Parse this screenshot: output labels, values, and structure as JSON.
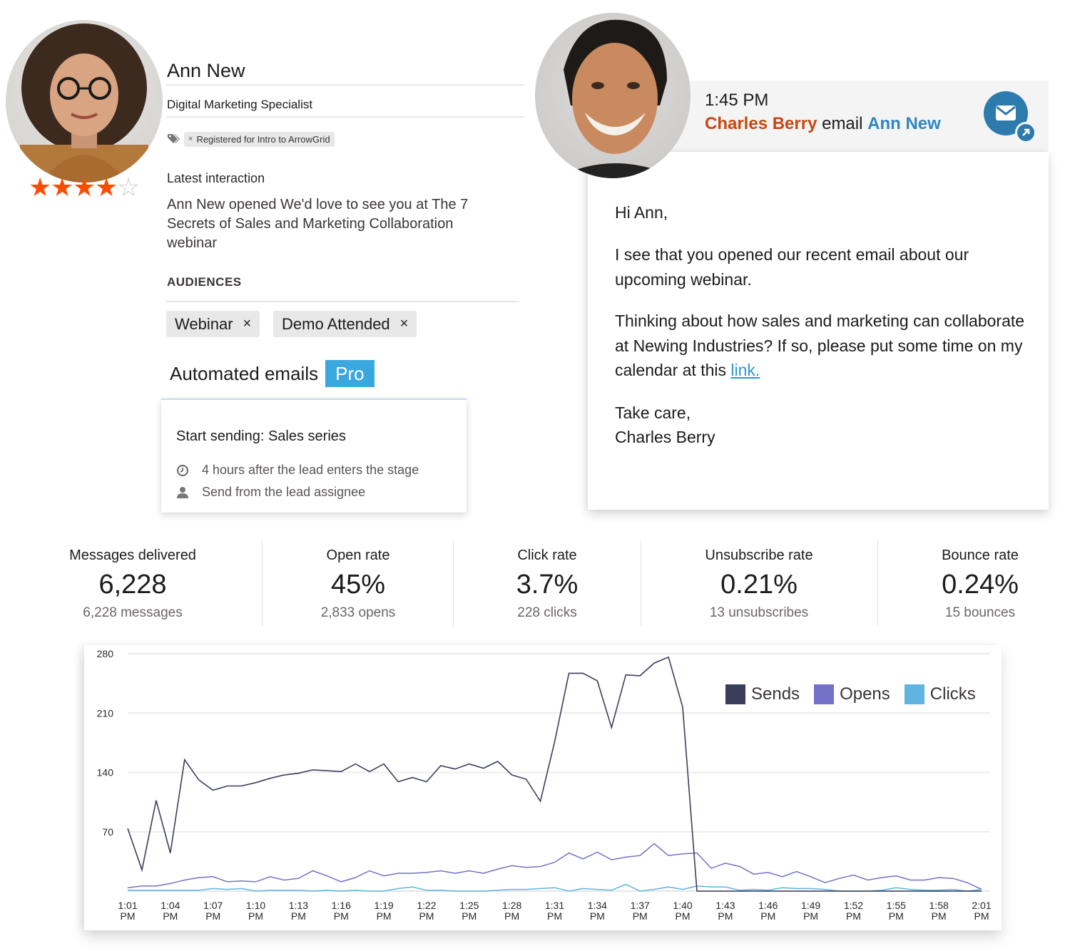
{
  "contact": {
    "name": "Ann New",
    "job_title": "Digital Marketing Specialist",
    "tag": "Registered for Intro to ArrowGrid",
    "tag_remove_glyph": "×",
    "rating": {
      "value": 4,
      "max": 5,
      "filled_glyph": "★",
      "empty_glyph": "☆"
    },
    "latest_interaction_label": "Latest interaction",
    "latest_interaction_text": "Ann New opened We'd love to see you at The 7 Secrets of Sales and Marketing Collaboration webinar",
    "audiences_label": "AUDIENCES",
    "audiences": [
      {
        "label": "Webinar",
        "remove_glyph": "×"
      },
      {
        "label": "Demo Attended",
        "remove_glyph": "×"
      }
    ]
  },
  "automation": {
    "title": "Automated emails",
    "badge": "Pro",
    "card_title": "Start sending: Sales series",
    "timing": "4 hours after the lead enters the stage",
    "sender": "Send from the lead assignee"
  },
  "email": {
    "time": "1:45 PM",
    "sender": "Charles Berry",
    "action": "email",
    "recipient": "Ann New",
    "greeting": "Hi Ann,",
    "paragraph1": "I see that you opened our recent email about our upcoming webinar.",
    "paragraph2_text": "Thinking about how sales and marketing can collaborate at Newing Industries? If so, please put some time on my calendar at this ",
    "paragraph2_link": "link.",
    "signoff": "Take care,",
    "signature": "Charles Berry"
  },
  "stats": [
    {
      "label": "Messages delivered",
      "value": "6,228",
      "sub": "6,228 messages"
    },
    {
      "label": "Open rate",
      "value": "45%",
      "sub": "2,833 opens"
    },
    {
      "label": "Click rate",
      "value": "3.7%",
      "sub": "228 clicks"
    },
    {
      "label": "Unsubscribe rate",
      "value": "0.21%",
      "sub": "13 unsubscribes"
    },
    {
      "label": "Bounce rate",
      "value": "0.24%",
      "sub": "15 bounces"
    }
  ],
  "colors": {
    "star": "#ff4d00",
    "sender": "#c9470f",
    "recipient": "#2f86c0",
    "pro": "#3aa8de",
    "mail_button": "#2c7bac"
  },
  "chart_data": {
    "type": "line",
    "title": "",
    "xlabel": "",
    "ylabel": "",
    "ylim": [
      0,
      280
    ],
    "yticks": [
      70,
      140,
      210,
      280
    ],
    "grid": true,
    "legend_position": "top-right",
    "x": [
      "1:01 PM",
      "1:02 PM",
      "1:03 PM",
      "1:04 PM",
      "1:05 PM",
      "1:06 PM",
      "1:07 PM",
      "1:08 PM",
      "1:09 PM",
      "1:10 PM",
      "1:11 PM",
      "1:12 PM",
      "1:13 PM",
      "1:14 PM",
      "1:15 PM",
      "1:16 PM",
      "1:17 PM",
      "1:18 PM",
      "1:19 PM",
      "1:20 PM",
      "1:21 PM",
      "1:22 PM",
      "1:23 PM",
      "1:24 PM",
      "1:25 PM",
      "1:26 PM",
      "1:27 PM",
      "1:28 PM",
      "1:29 PM",
      "1:30 PM",
      "1:31 PM",
      "1:32 PM",
      "1:33 PM",
      "1:34 PM",
      "1:35 PM",
      "1:36 PM",
      "1:37 PM",
      "1:38 PM",
      "1:39 PM",
      "1:40 PM",
      "1:41 PM",
      "1:42 PM",
      "1:43 PM",
      "1:44 PM",
      "1:45 PM",
      "1:46 PM",
      "1:47 PM",
      "1:48 PM",
      "1:49 PM",
      "1:50 PM",
      "1:51 PM",
      "1:52 PM",
      "1:53 PM",
      "1:54 PM",
      "1:55 PM",
      "1:56 PM",
      "1:57 PM",
      "1:58 PM",
      "1:59 PM",
      "2:00 PM",
      "2:01 PM"
    ],
    "xtick_labels": [
      [
        "1:01",
        "PM"
      ],
      [
        "1:04",
        "PM"
      ],
      [
        "1:07",
        "PM"
      ],
      [
        "1:10",
        "PM"
      ],
      [
        "1:13",
        "PM"
      ],
      [
        "1:16",
        "PM"
      ],
      [
        "1:19",
        "PM"
      ],
      [
        "1:22",
        "PM"
      ],
      [
        "1:25",
        "PM"
      ],
      [
        "1:28",
        "PM"
      ],
      [
        "1:31",
        "PM"
      ],
      [
        "1:34",
        "PM"
      ],
      [
        "1:37",
        "PM"
      ],
      [
        "1:40",
        "PM"
      ],
      [
        "1:43",
        "PM"
      ],
      [
        "1:46",
        "PM"
      ],
      [
        "1:49",
        "PM"
      ],
      [
        "1:52",
        "PM"
      ],
      [
        "1:55",
        "PM"
      ],
      [
        "1:58",
        "PM"
      ],
      [
        "2:01",
        "PM"
      ]
    ],
    "xtick_every": 3,
    "series": [
      {
        "name": "Sends",
        "color": "#3b3d5e",
        "values": [
          74,
          25,
          107,
          45,
          155,
          131,
          119,
          124,
          124,
          128,
          133,
          137,
          139,
          143,
          142,
          141,
          150,
          141,
          150,
          129,
          134,
          129,
          148,
          144,
          150,
          145,
          153,
          137,
          132,
          106,
          176,
          257,
          257,
          248,
          193,
          255,
          254,
          269,
          276,
          217,
          0,
          0,
          0,
          0,
          0,
          0,
          0,
          0,
          0,
          0,
          0,
          0,
          0,
          0,
          0,
          0,
          0,
          0,
          0,
          0,
          0
        ]
      },
      {
        "name": "Opens",
        "color": "#7471c8",
        "values": [
          4,
          6,
          6,
          9,
          13,
          16,
          17,
          11,
          12,
          11,
          17,
          13,
          15,
          24,
          18,
          11,
          16,
          24,
          18,
          21,
          21,
          22,
          24,
          21,
          24,
          21,
          26,
          30,
          28,
          29,
          34,
          45,
          38,
          46,
          37,
          40,
          42,
          56,
          42,
          44,
          45,
          27,
          33,
          29,
          20,
          22,
          17,
          23,
          17,
          10,
          15,
          19,
          13,
          16,
          18,
          13,
          13,
          16,
          15,
          10,
          2
        ]
      },
      {
        "name": "Clicks",
        "color": "#5fb4e0",
        "values": [
          1,
          1,
          1,
          1,
          1,
          1,
          3,
          2,
          3,
          0,
          1,
          1,
          1,
          0,
          1,
          0,
          1,
          0,
          0,
          3,
          5,
          1,
          1,
          0,
          0,
          0,
          1,
          2,
          2,
          3,
          4,
          0,
          3,
          2,
          1,
          8,
          0,
          2,
          5,
          2,
          6,
          5,
          5,
          1,
          2,
          1,
          4,
          3,
          3,
          2,
          0,
          0,
          0,
          1,
          4,
          2,
          1,
          1,
          2,
          0,
          2
        ]
      }
    ]
  }
}
